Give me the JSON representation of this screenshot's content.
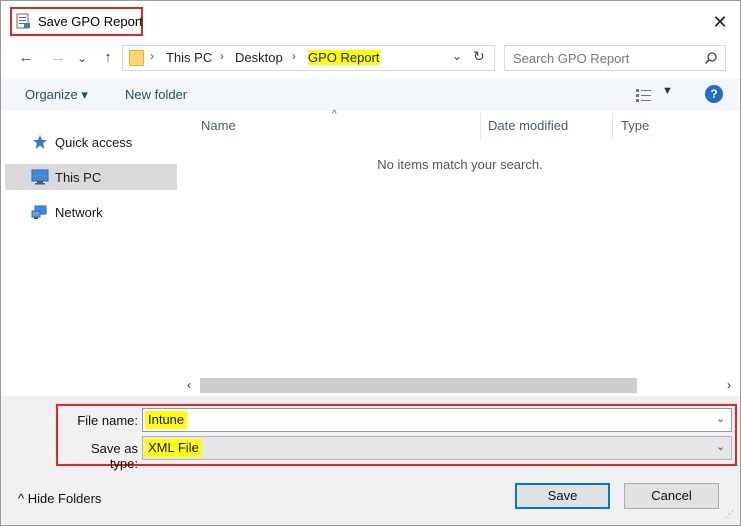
{
  "window": {
    "title": "Save GPO Report",
    "close_glyph": "✕"
  },
  "address": {
    "back": "←",
    "forward": "→",
    "recent": "⌄",
    "up": "↑",
    "crumbs": [
      "This PC",
      "Desktop",
      "GPO Report"
    ],
    "sep": "›",
    "dropdown": "⌄",
    "refresh": "↻"
  },
  "search": {
    "placeholder": "Search GPO Report"
  },
  "toolbar": {
    "organize": "Organize ▾",
    "new_folder": "New folder",
    "view_drop": "▼",
    "help": "?"
  },
  "nav_pane": {
    "items": [
      {
        "label": "Quick access",
        "icon": "star-icon"
      },
      {
        "label": "This PC",
        "icon": "computer-icon",
        "selected": true
      },
      {
        "label": "Network",
        "icon": "network-icon"
      }
    ]
  },
  "file_list": {
    "columns": [
      "Name",
      "Date modified",
      "Type"
    ],
    "sort_indicator": "^",
    "empty_message": "No items match your search."
  },
  "scrollbar": {
    "left": "‹",
    "right": "›"
  },
  "form": {
    "file_name_label": "File name:",
    "file_name_value": "Intune",
    "save_type_label": "Save as type:",
    "save_type_value": "XML File",
    "drop": "⌄"
  },
  "footer": {
    "hide_folders": "^  Hide Folders",
    "save": "Save",
    "cancel": "Cancel"
  },
  "colors": {
    "highlight_border": "#e0262b",
    "highlight_fill": "#ffff00",
    "accent": "#0078d7"
  }
}
